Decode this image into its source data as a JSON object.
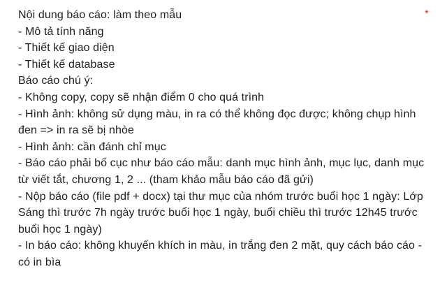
{
  "question": {
    "required_marker": "*",
    "lines": [
      "Nội dung báo cáo: làm theo mẫu",
      "- Mô tả tính năng",
      "- Thiết kế giao diện",
      "- Thiết kế database",
      "Báo cáo chú ý:",
      "- Không copy, copy sẽ nhận điểm 0 cho quá trình",
      "- Hình ảnh: không sử dụng màu, in ra có thể không đọc được; không chụp hình",
      "đen => in ra sẽ bị nhòe",
      "- Hình ảnh: cần đánh chỉ mục",
      "- Báo cáo phải bố cục như báo cáo mẫu: danh mục hình ảnh, mục lục, danh mục",
      "từ viết tắt, chương 1, 2 ... (tham khảo mẫu báo cáo đã gửi)",
      "- Nộp báo cáo (file pdf + docx) tại thư mục của nhóm trước buổi học 1 ngày: Lớp",
      "Sáng thì trước 7h ngày trước buổi học 1 ngày, buổi chiều thì trước 12h45 trước",
      "buổi học 1 ngày)",
      "- In báo cáo: không khuyến khích in màu, in trắng đen 2 mặt, quy cách báo cáo -",
      "có in bìa"
    ]
  },
  "colors": {
    "text": "#202124",
    "required": "#d93025",
    "background": "#ffffff"
  }
}
